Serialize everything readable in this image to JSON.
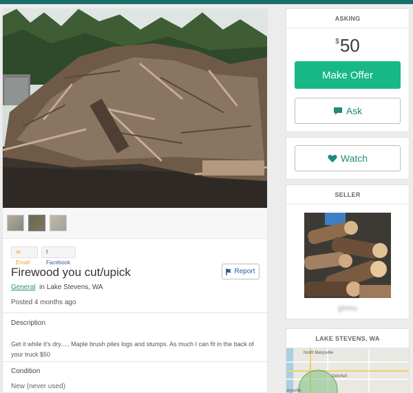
{
  "share": {
    "email": "Email",
    "facebook": "Facebook"
  },
  "listing": {
    "title": "Firewood you cut/upick",
    "report_label": "Report",
    "category": "General",
    "location": "in Lake Stevens, WA",
    "posted": "Posted 4 months ago",
    "description_label": "Description",
    "description": "Get it while it's dry..... Maple brush piles logs and stumps. As much I can fit in the back of your truck $50",
    "condition_label": "Condition",
    "condition": "New (never used)"
  },
  "asking": {
    "header": "ASKING",
    "currency": "$",
    "price": "50",
    "offer_label": "Make Offer",
    "ask_label": "Ask"
  },
  "watch": {
    "label": "Watch"
  },
  "seller": {
    "header": "SELLER",
    "name": "jjjbbby"
  },
  "map": {
    "header": "LAKE STEVENS, WA",
    "labels": [
      "North Marysville",
      "Getchell",
      "arysville"
    ]
  },
  "colors": {
    "accent": "#17b886",
    "accent_text": "#1f8a78",
    "topbar": "#1a6e6a",
    "report": "#2c5aa0"
  }
}
